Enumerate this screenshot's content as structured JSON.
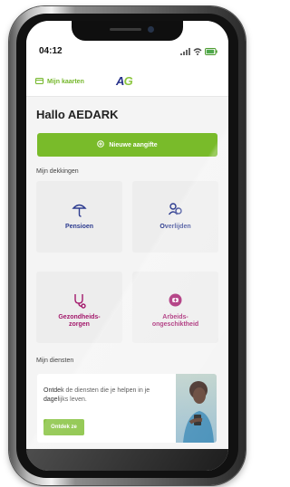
{
  "status_bar": {
    "time": "04:12"
  },
  "header": {
    "cards_label": "Mijn kaarten",
    "logo_ag_a": "A",
    "logo_ag_g": "G"
  },
  "greeting": "Hallo AEDARK",
  "primary_action": {
    "label": "Nieuwe aangifte"
  },
  "coverages": {
    "title": "Mijn dekkingen",
    "items": [
      {
        "label": "Pensioen",
        "icon": "umbrella-icon"
      },
      {
        "label": "Overlijden",
        "icon": "people-icon"
      },
      {
        "label": "Gezondheids-\nzorgen",
        "icon": "stethoscope-icon"
      },
      {
        "label": "Arbeids-\nongeschiktheid",
        "icon": "medical-kit-icon"
      }
    ]
  },
  "services": {
    "title": "Mijn diensten",
    "promo_text": "Ontdek de diensten die je helpen in je dagelijks leven.",
    "promo_button": "Ontdek ze",
    "photo_icon": "woman-phone-photo"
  },
  "colors": {
    "accent_green": "#79bb2a",
    "brand_blue": "#26308a",
    "pink": "#a3186b"
  }
}
